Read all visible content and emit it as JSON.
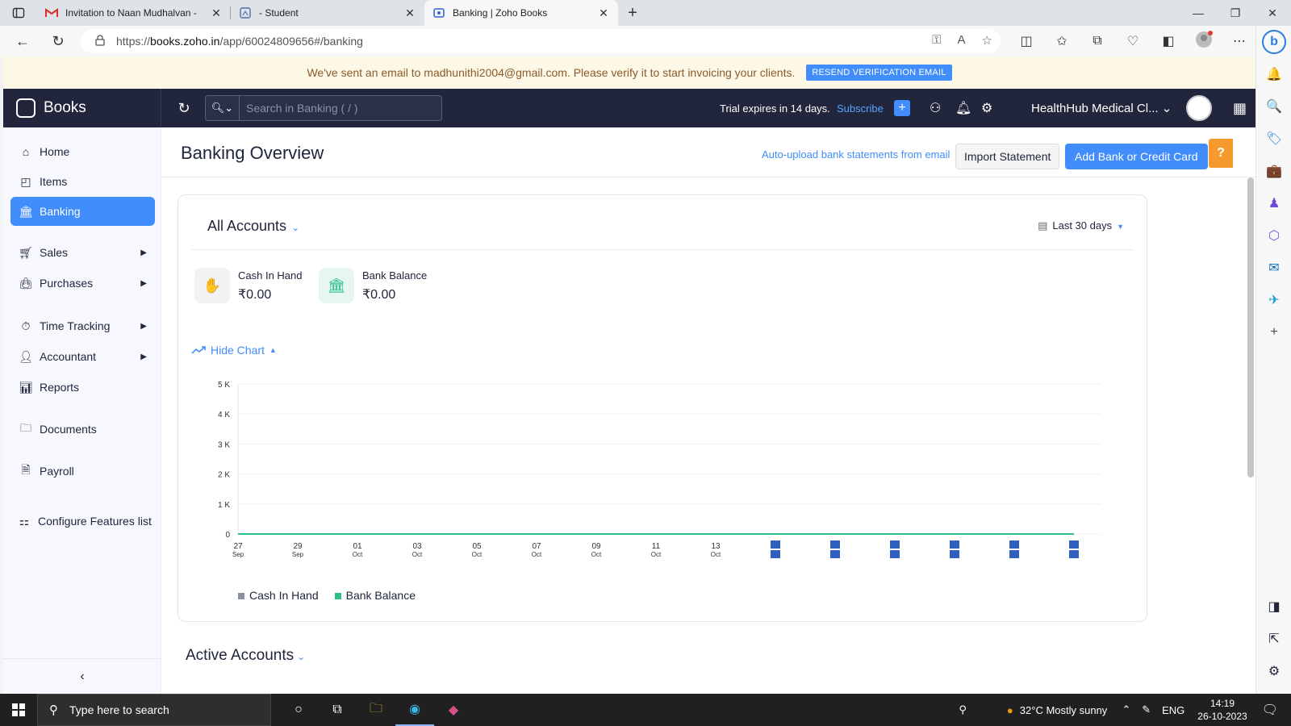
{
  "browser": {
    "tabs": [
      {
        "title": "Invitation to Naan Mudhalvan - ",
        "icon": "gmail-icon"
      },
      {
        "title": "- Student",
        "icon": "document-icon"
      },
      {
        "title": "Banking | Zoho Books",
        "icon": "books-icon"
      }
    ],
    "url_prefix": "https://",
    "url_host": "books.zoho.in",
    "url_path": "/app/60024809656#/banking"
  },
  "banner": {
    "message": "We've sent an email to madhunithi2004@gmail.com. Please verify it to start invoicing your clients.",
    "button": "RESEND VERIFICATION EMAIL"
  },
  "topnav": {
    "brand": "Books",
    "search_placeholder": "Search in Banking ( / )",
    "trial": "Trial expires in 14 days.",
    "subscribe": "Subscribe",
    "org": "HealthHub Medical Cl..."
  },
  "sidebar": {
    "items": [
      {
        "label": "Home",
        "icon": "home-icon"
      },
      {
        "label": "Items",
        "icon": "items-icon"
      },
      {
        "label": "Banking",
        "icon": "bank-icon",
        "active": true
      },
      {
        "label": "Sales",
        "icon": "cart-icon"
      },
      {
        "label": "Purchases",
        "icon": "bag-icon"
      },
      {
        "label": "Time Tracking",
        "icon": "clock-icon"
      },
      {
        "label": "Accountant",
        "icon": "accountant-icon"
      },
      {
        "label": "Reports",
        "icon": "reports-icon"
      },
      {
        "label": "Documents",
        "icon": "folder-icon"
      },
      {
        "label": "Payroll",
        "icon": "payroll-icon"
      },
      {
        "label": "Configure Features list",
        "icon": "configure-icon"
      }
    ]
  },
  "main": {
    "title": "Banking Overview",
    "auto_upload": "Auto-upload bank statements from email",
    "import_btn": "Import Statement",
    "add_btn": "Add Bank or Credit Card",
    "help": "?",
    "accounts_selector": "All Accounts",
    "period": "Last 30 days",
    "cash_label": "Cash In Hand",
    "cash_value": "₹0.00",
    "bank_label": "Bank Balance",
    "bank_value": "₹0.00",
    "hide_chart": "Hide Chart",
    "active_accounts": "Active Accounts"
  },
  "chart_data": {
    "type": "line",
    "title": "",
    "xlabel": "",
    "ylabel": "",
    "ylim": [
      0,
      5000
    ],
    "y_ticks": [
      "0",
      "1 K",
      "2 K",
      "3 K",
      "4 K",
      "5 K"
    ],
    "x_ticks": [
      [
        "27",
        "Sep"
      ],
      [
        "29",
        "Sep"
      ],
      [
        "01",
        "Oct"
      ],
      [
        "03",
        "Oct"
      ],
      [
        "05",
        "Oct"
      ],
      [
        "07",
        "Oct"
      ],
      [
        "09",
        "Oct"
      ],
      [
        "11",
        "Oct"
      ],
      [
        "13",
        "Oct"
      ],
      [
        "",
        ""
      ],
      [
        "",
        ""
      ],
      [
        "",
        ""
      ],
      [
        "",
        ""
      ],
      [
        "",
        ""
      ],
      [
        "",
        ""
      ]
    ],
    "series": [
      {
        "name": "Cash In Hand",
        "color": "#8a8fa3",
        "values": [
          0,
          0,
          0,
          0,
          0,
          0,
          0,
          0,
          0,
          0,
          0,
          0,
          0,
          0,
          0
        ]
      },
      {
        "name": "Bank Balance",
        "color": "#2bbf8a",
        "values": [
          0,
          0,
          0,
          0,
          0,
          0,
          0,
          0,
          0,
          0,
          0,
          0,
          0,
          0,
          0
        ]
      }
    ],
    "grid": true,
    "legend": "bottom-left"
  },
  "taskbar": {
    "search": "Type here to search",
    "weather": "32°C  Mostly sunny",
    "lang": "ENG",
    "time": "14:19",
    "date": "26-10-2023"
  }
}
